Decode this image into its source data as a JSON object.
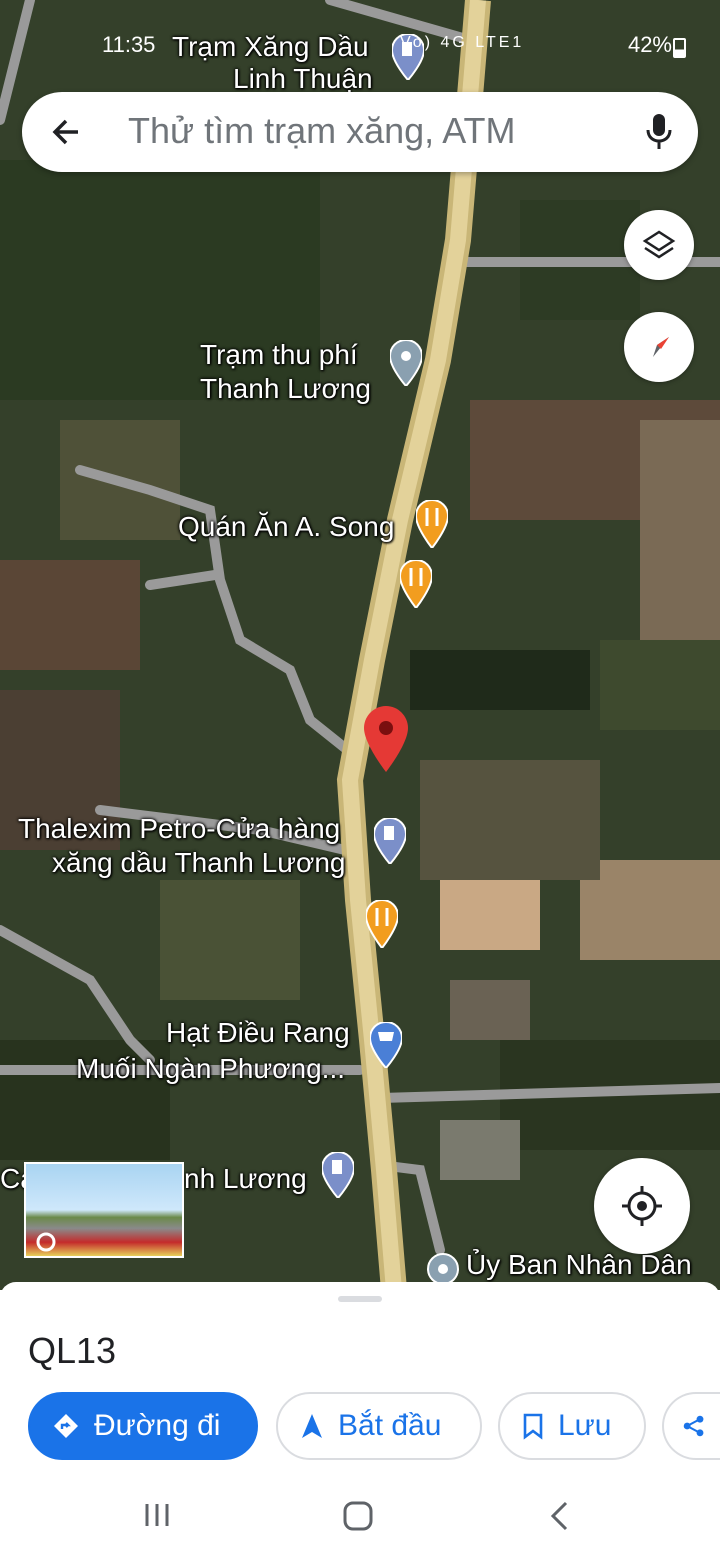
{
  "status_bar": {
    "time": "11:35",
    "network": "Vo) 4G LTE1",
    "battery": "42%"
  },
  "search": {
    "placeholder": "Thử tìm trạm xăng, ATM"
  },
  "map": {
    "labels": {
      "gas_top_line1": "Trạm Xăng Dầu",
      "gas_top_line2": "Linh Thuận",
      "toll_line1": "Trạm thu phí",
      "toll_line2": "Thanh Lương",
      "restaurant": "Quán Ăn A. Song",
      "thalexim_line1": "Thalexim Petro-Cửa hàng",
      "thalexim_line2": "xăng dầu Thanh Lương",
      "cashew_line1": "Hạt Điều Rang",
      "cashew_line2": "Muối Ngàn Phương...",
      "gas_bottom_left": "Cả",
      "gas_bottom_right": "nh Lương",
      "committee": "Ủy Ban Nhân Dân"
    },
    "icons": {
      "layers": "layers-icon",
      "compass": "compass-icon",
      "my_location": "my-location-icon"
    },
    "colors": {
      "road_main": "#d9c58a",
      "road_minor": "#9a9a9a",
      "pin_red": "#e53935",
      "pin_orange": "#f29d1f",
      "pin_blue": "#7b8fc9"
    }
  },
  "sheet": {
    "title": "QL13",
    "actions": {
      "directions": "Đường đi",
      "start": "Bắt đầu",
      "save": "Lưu"
    },
    "accent": "#1a73e8"
  }
}
